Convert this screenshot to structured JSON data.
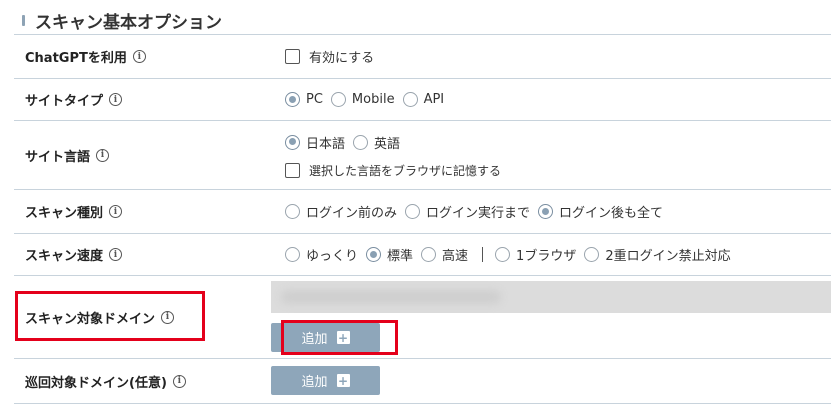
{
  "section": {
    "title": "スキャン基本オプション"
  },
  "rows": {
    "chatgpt": {
      "label": "ChatGPTを利用",
      "option": "有効にする",
      "checked": false
    },
    "site_type": {
      "label": "サイトタイプ",
      "options": [
        "PC",
        "Mobile",
        "API"
      ],
      "selected": "PC"
    },
    "site_lang": {
      "label": "サイト言語",
      "options": [
        "日本語",
        "英語"
      ],
      "selected": "日本語",
      "remember_label": "選択した言語をブラウザに記憶する",
      "remember_checked": false
    },
    "scan_kind": {
      "label": "スキャン種別",
      "options": [
        "ログイン前のみ",
        "ログイン実行まで",
        "ログイン後も全て"
      ],
      "selected": "ログイン後も全て"
    },
    "scan_speed": {
      "label": "スキャン速度",
      "options": [
        "ゆっくり",
        "標準",
        "高速"
      ],
      "extra_options": [
        "1ブラウザ",
        "2重ログイン禁止対応"
      ],
      "selected": "標準"
    },
    "target_domain": {
      "label": "スキャン対象ドメイン",
      "add_label": "追加"
    },
    "crawl_domain": {
      "label": "巡回対象ドメイン(任意)",
      "add_label": "追加"
    }
  },
  "colors": {
    "highlight": "#e4001b",
    "button": "#8ea6ba",
    "rule": "#c8d3dc"
  },
  "icons": {
    "info": "info-icon",
    "add": "plus-icon"
  }
}
